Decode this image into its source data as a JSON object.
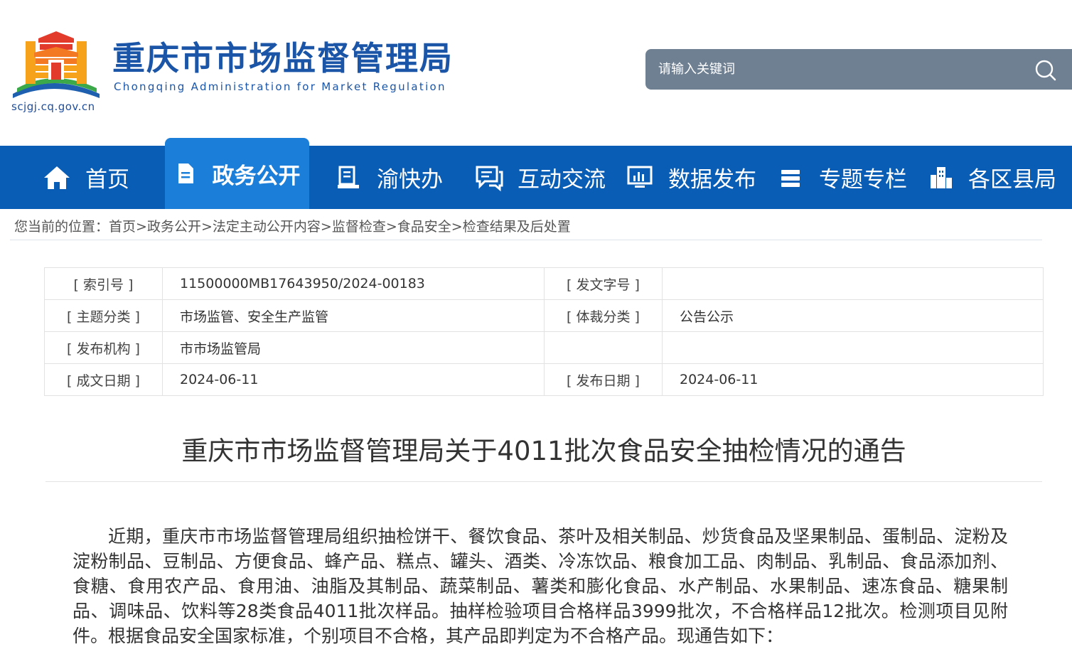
{
  "header": {
    "site_title": "重庆市市场监督管理局",
    "site_subtitle": "Chongqing  Administration for Market Regulation",
    "site_url": "scjgj.cq.gov.cn",
    "logo_icon": "tiananmen-emblem-logo",
    "search": {
      "placeholder": "请输入关键词",
      "icon": "search-icon"
    }
  },
  "nav": {
    "items": [
      {
        "label": "首页",
        "icon": "home-icon",
        "active": false
      },
      {
        "label": "政务公开",
        "icon": "document-icon",
        "active": true
      },
      {
        "label": "渝快办",
        "icon": "stamp-icon",
        "active": false
      },
      {
        "label": "互动交流",
        "icon": "chat-icon",
        "active": false
      },
      {
        "label": "数据发布",
        "icon": "monitor-chart-icon",
        "active": false
      },
      {
        "label": "专题专栏",
        "icon": "stack-icon",
        "active": false
      },
      {
        "label": "各区县局",
        "icon": "buildings-icon",
        "active": false
      }
    ]
  },
  "breadcrumb": {
    "prefix": "您当前的位置：",
    "items": [
      "首页",
      "政务公开",
      "法定主动公开内容",
      "监督检查",
      "食品安全",
      "检查结果及后处置"
    ],
    "separator": ">"
  },
  "meta": {
    "index_label": "[ 索引号 ]",
    "index_value": "11500000MB17643950/2024-00183",
    "doc_no_label": "[ 发文字号 ]",
    "doc_no_value": "",
    "subject_label": "[ 主题分类 ]",
    "subject_value": "市场监管、安全生产监管",
    "genre_label": "[ 体裁分类 ]",
    "genre_value": "公告公示",
    "org_label": "[ 发布机构 ]",
    "org_value": "市市场监管局",
    "created_label": "[ 成文日期 ]",
    "created_value": "2024-06-11",
    "published_label": "[ 发布日期 ]",
    "published_value": "2024-06-11"
  },
  "article": {
    "title": "重庆市市场监督管理局关于4011批次食品安全抽检情况的通告",
    "body": "近期，重庆市市场监督管理局组织抽检饼干、餐饮食品、茶叶及相关制品、炒货食品及坚果制品、蛋制品、淀粉及淀粉制品、豆制品、方便食品、蜂产品、糕点、罐头、酒类、冷冻饮品、粮食加工品、肉制品、乳制品、食品添加剂、食糖、食用农产品、食用油、油脂及其制品、蔬菜制品、薯类和膨化食品、水产制品、水果制品、速冻食品、糖果制品、调味品、饮料等28类食品4011批次样品。抽样检验项目合格样品3999批次，不合格样品12批次。检测项目见附件。根据食品安全国家标准，个别项目不合格，其产品即判定为不合格产品。现通告如下："
  },
  "colors": {
    "nav_bg": "#0a5db5",
    "nav_active_bg": "#1b7ed9",
    "title_blue": "#1a55a8",
    "search_bg": "#6f8093"
  }
}
